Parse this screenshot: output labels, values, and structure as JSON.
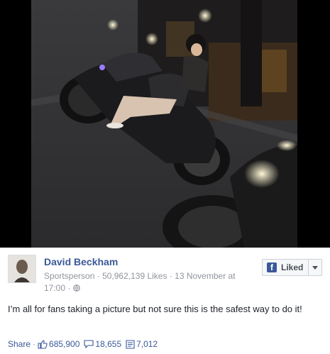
{
  "post": {
    "author_name": "David Beckham",
    "author_category": "Sportsperson",
    "likes_count": "50,962,139 Likes",
    "date": "13 November at 17:00",
    "liked_label": "Liked",
    "caption": "I’m all for fans taking a picture but not sure this is the safest way to do it!"
  },
  "footer": {
    "share_label": "Share",
    "likes": "685,900",
    "comments": "18,655",
    "shares": "7,012"
  },
  "colors": {
    "link_blue": "#3b5998",
    "meta_gray": "#90949c"
  }
}
